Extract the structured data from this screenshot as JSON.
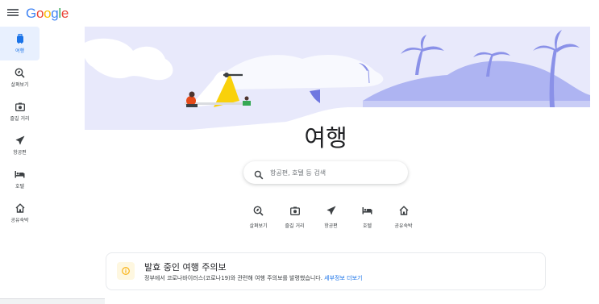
{
  "header": {
    "logo": "Google"
  },
  "sidebar": {
    "items": [
      {
        "label": "여행",
        "icon": "suitcase-icon",
        "active": true
      },
      {
        "label": "살펴보기",
        "icon": "explore-icon",
        "active": false
      },
      {
        "label": "즐길 거리",
        "icon": "camera-icon",
        "active": false
      },
      {
        "label": "항공편",
        "icon": "airplane-icon",
        "active": false
      },
      {
        "label": "호텔",
        "icon": "bed-icon",
        "active": false
      },
      {
        "label": "공유숙박",
        "icon": "home-icon",
        "active": false
      }
    ]
  },
  "main": {
    "title": "여행",
    "search": {
      "placeholder": "항공편, 호텔 등 검색"
    },
    "quick_links": [
      {
        "label": "살펴보기",
        "icon": "explore-icon"
      },
      {
        "label": "즐길 거리",
        "icon": "camera-icon"
      },
      {
        "label": "항공편",
        "icon": "airplane-icon"
      },
      {
        "label": "호텔",
        "icon": "bed-icon"
      },
      {
        "label": "공유숙박",
        "icon": "home-icon"
      }
    ]
  },
  "advisory": {
    "title": "발효 중인 여행 주의보",
    "body": "정부에서 코로나바이러스(코로나19)와 관련해 여행 주의보를 발령했습니다.",
    "link": "세부정보 더보기"
  },
  "colors": {
    "accent": "#1a73e8",
    "hero_bg": "#e8e9fb",
    "hero_shape": "#aeb4f2",
    "advisory_icon": "#f9ab00"
  }
}
